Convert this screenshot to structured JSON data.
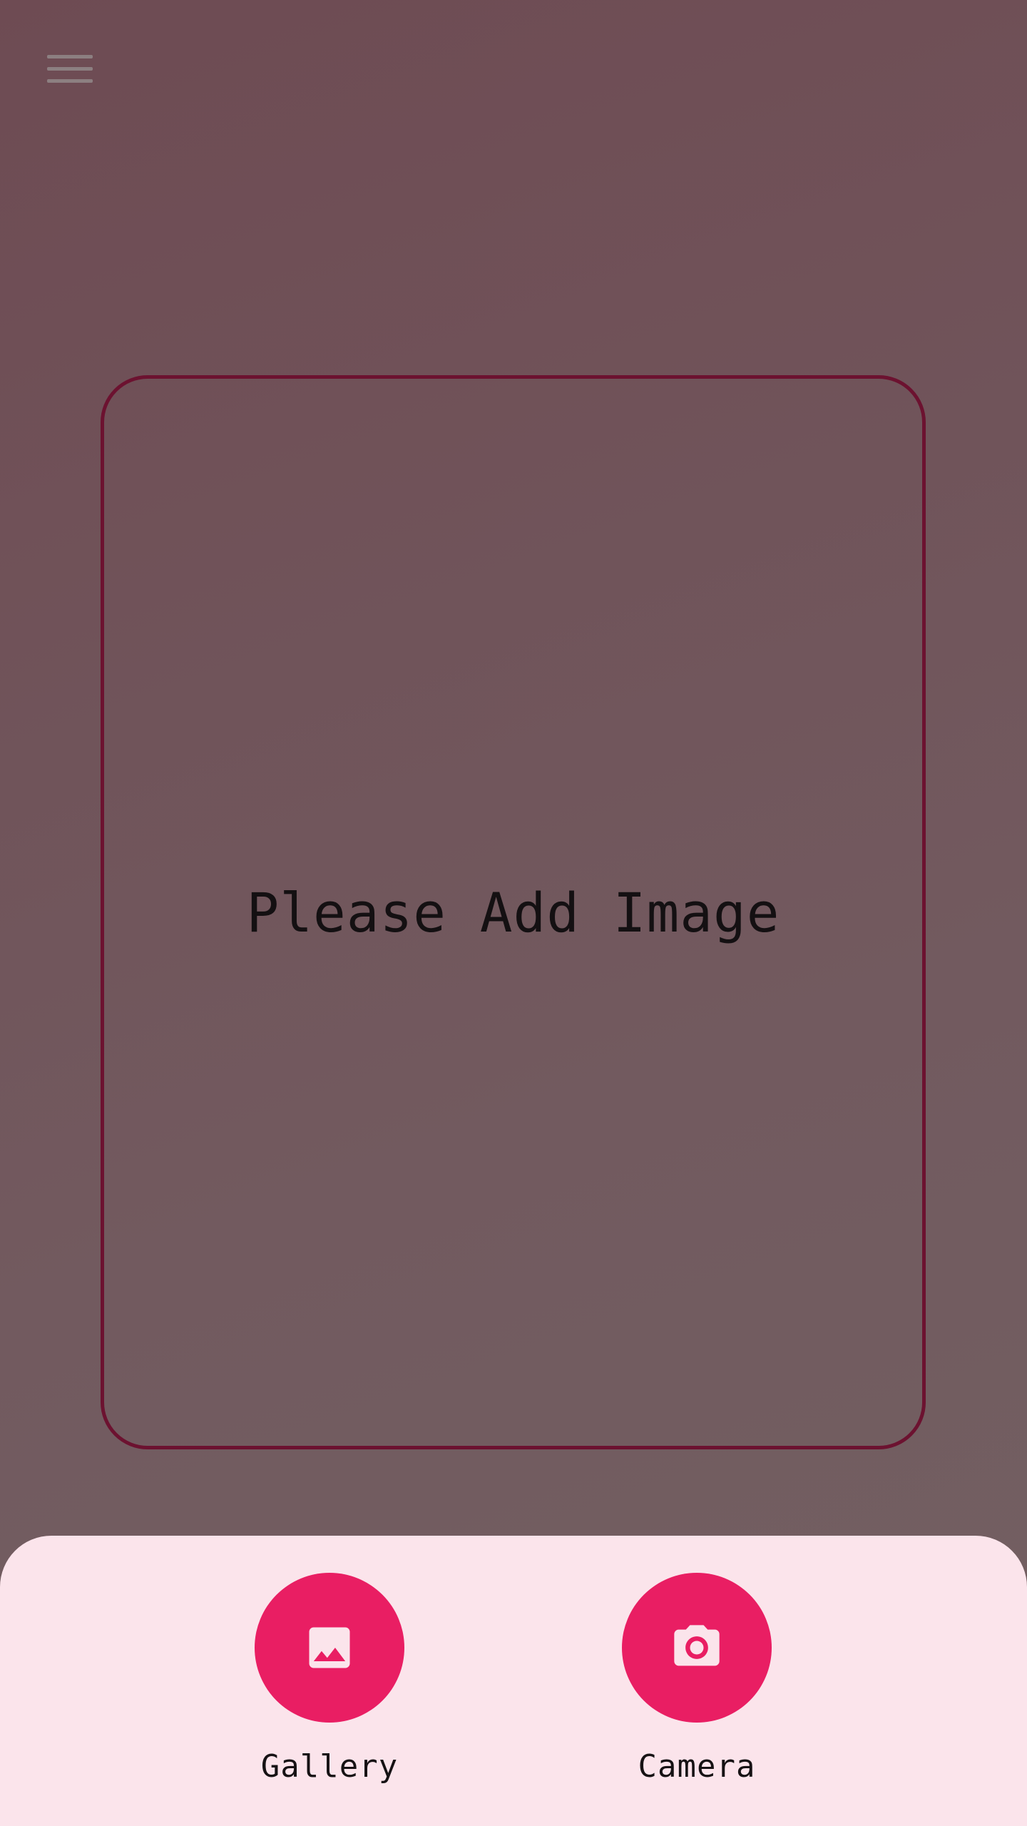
{
  "header": {
    "menu_icon": "hamburger-menu-icon"
  },
  "preview": {
    "placeholder_text": "Please Add Image"
  },
  "actions": [
    {
      "label": "Gallery",
      "icon": "image-icon"
    },
    {
      "label": "Camera",
      "icon": "camera-icon"
    }
  ],
  "colors": {
    "background": "#6e4b53",
    "frame_border": "#6c1230",
    "sheet_background": "#fbe4eb",
    "accent": "#e91e63",
    "menu_icon": "#8c7f81"
  }
}
